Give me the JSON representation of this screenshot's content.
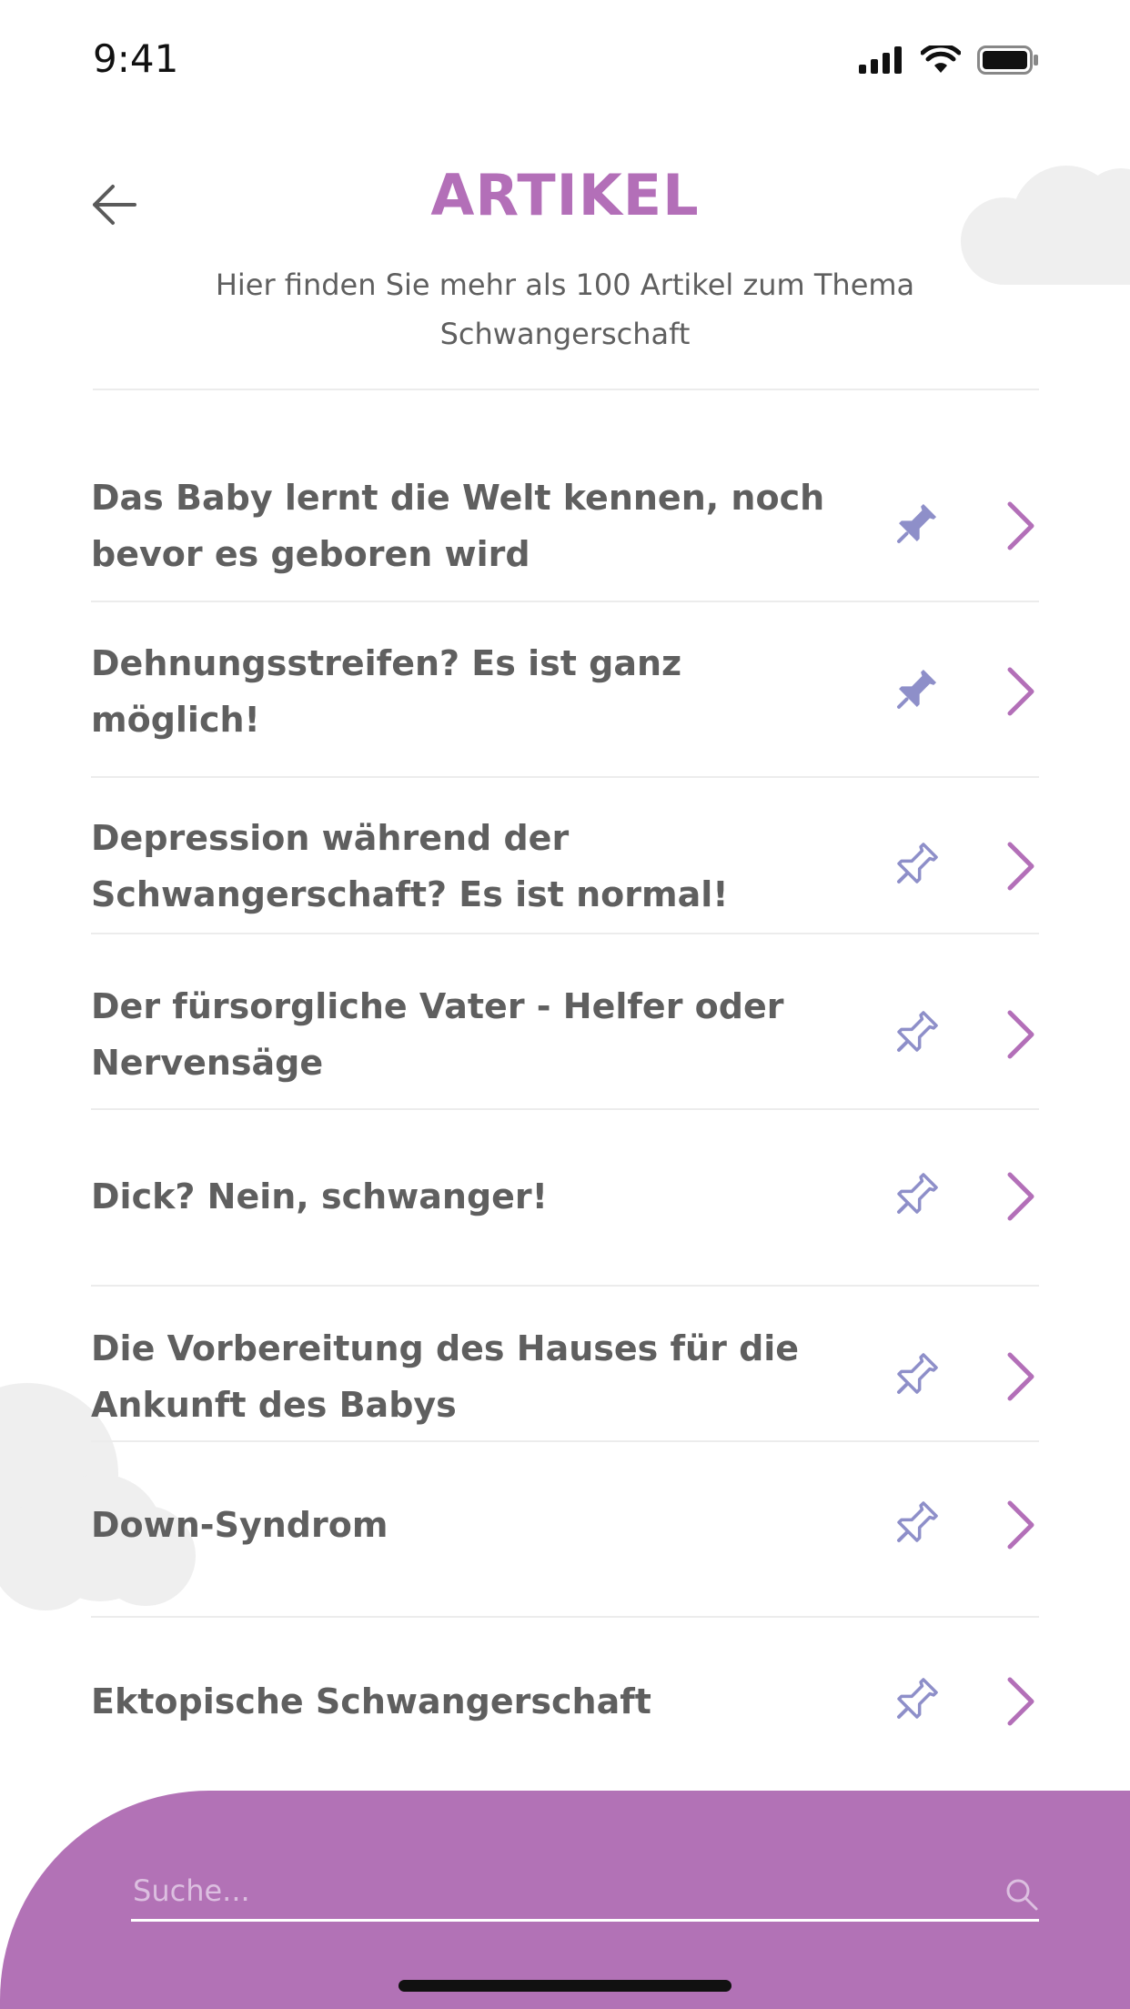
{
  "status_bar": {
    "time": "9:41"
  },
  "header": {
    "title": "ARTIKEL",
    "subtitle_line1": "Hier finden Sie mehr als 100 Artikel zum Thema",
    "subtitle_line2": "Schwangerschaft"
  },
  "articles": [
    {
      "title": "Das Baby lernt die Welt kennen, noch bevor es geboren wird",
      "pinned": true
    },
    {
      "title": "Dehnungsstreifen? Es ist ganz möglich!",
      "pinned": true
    },
    {
      "title": "Depression während der Schwangerschaft? Es ist normal!",
      "pinned": false
    },
    {
      "title": "Der fürsorgliche Vater - Helfer oder Nervensäge",
      "pinned": false
    },
    {
      "title": "Dick? Nein, schwanger!",
      "pinned": false
    },
    {
      "title": "Die Vorbereitung des Hauses für die Ankunft des Babys",
      "pinned": false
    },
    {
      "title": "Down-Syndrom",
      "pinned": false
    },
    {
      "title": "Ektopische Schwangerschaft",
      "pinned": false
    }
  ],
  "search": {
    "placeholder": "Suche..."
  },
  "icons": {
    "back": "arrow-left-icon",
    "pin": "pushpin-icon",
    "chevron": "chevron-right-icon",
    "search": "magnifier-icon"
  },
  "colors": {
    "accent": "#b36fb8",
    "pin": "#8e8fc9",
    "bottom_panel": "#b272b6",
    "text": "#5f5f5f"
  }
}
